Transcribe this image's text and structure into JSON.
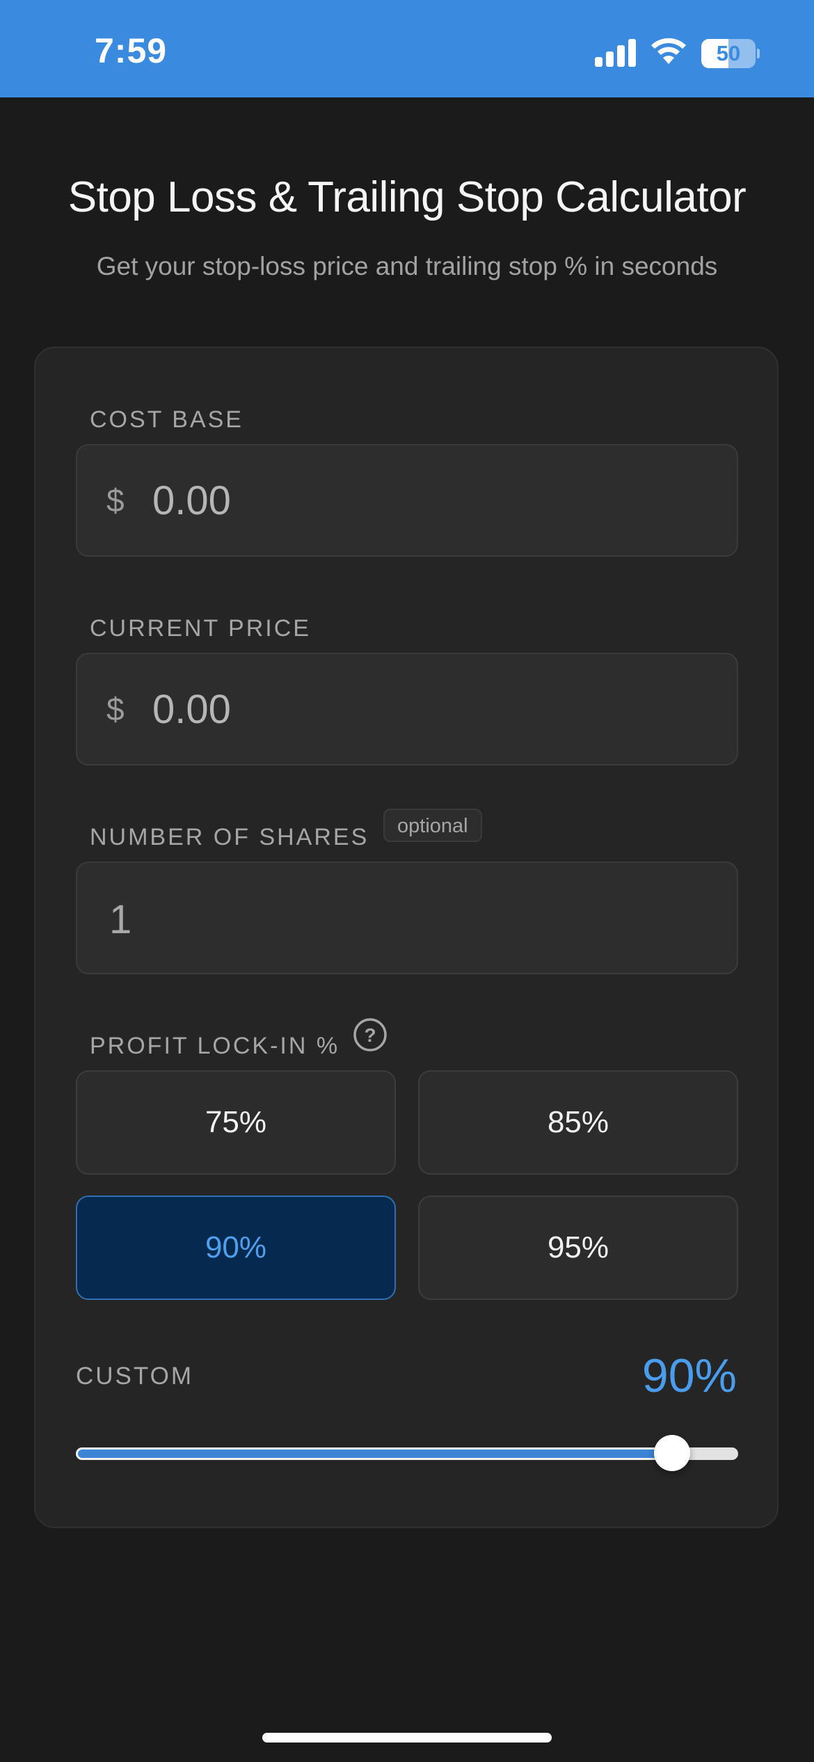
{
  "status_bar": {
    "time": "7:59",
    "battery_level": "50",
    "battery_fraction": 0.5,
    "background_color": "#3a8be0"
  },
  "header": {
    "title": "Stop Loss & Trailing Stop Calculator",
    "subtitle": "Get your stop-loss price and trailing stop % in seconds"
  },
  "form": {
    "cost_base": {
      "label": "COST BASE",
      "currency_symbol": "$",
      "placeholder": "0.00"
    },
    "current_price": {
      "label": "CURRENT PRICE",
      "currency_symbol": "$",
      "placeholder": "0.00"
    },
    "shares": {
      "label": "NUMBER OF SHARES",
      "badge": "optional",
      "value": "1"
    },
    "profit_lock": {
      "label": "PROFIT LOCK-IN %",
      "help_icon": "question-circle-icon",
      "presets": [
        "75%",
        "85%",
        "90%",
        "95%"
      ],
      "selected": "90%",
      "accent_color": "#4a9ded"
    },
    "custom": {
      "label": "CUSTOM",
      "value_text": "90%",
      "slider_value": 90,
      "slider_min": 0,
      "slider_max": 100
    }
  }
}
